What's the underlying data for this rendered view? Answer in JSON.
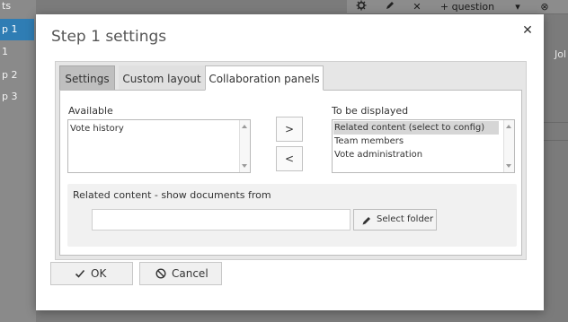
{
  "background": {
    "sidebar_items": [
      "ts",
      "p 1",
      "1",
      "p 2",
      "p 3"
    ],
    "active_sidebar_index": 1,
    "toolbar": {
      "question_label": "question"
    },
    "right_text": "Jol"
  },
  "dialog": {
    "title": "Step 1 settings",
    "tabs": [
      {
        "label": "Settings"
      },
      {
        "label": "Custom layout"
      },
      {
        "label": "Collaboration panels"
      }
    ],
    "active_tab": "Collaboration panels",
    "available_label": "Available",
    "available_items": [
      "Vote history"
    ],
    "displayed_label": "To be displayed",
    "displayed_items": [
      "Related content (select to config)",
      "Team members",
      "Vote administration"
    ],
    "selected_displayed_index": 0,
    "move_right_label": ">",
    "move_left_label": "<",
    "related_label": "Related content - show documents from",
    "folder_input_value": "",
    "select_folder_label": "Select folder",
    "ok_label": "OK",
    "cancel_label": "Cancel",
    "colors": {
      "accent_blue": "#2f7db4",
      "selected_item_bg": "#d6d6d6"
    }
  }
}
